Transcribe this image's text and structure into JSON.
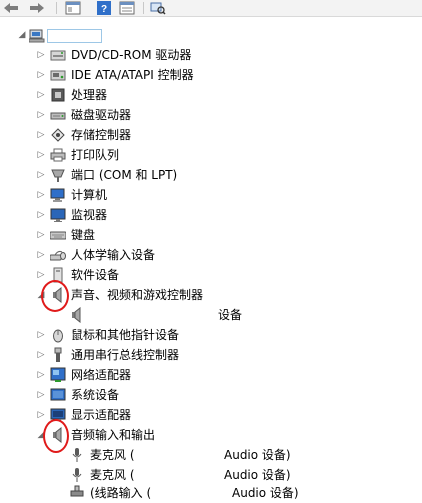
{
  "tree": {
    "root": {
      "label": ""
    },
    "categories": [
      {
        "label": "DVD/CD-ROM 驱动器",
        "icon": "dvd-drive-icon"
      },
      {
        "label": "IDE ATA/ATAPI 控制器",
        "icon": "ide-controller-icon"
      },
      {
        "label": "处理器",
        "icon": "processor-icon"
      },
      {
        "label": "磁盘驱动器",
        "icon": "disk-drive-icon"
      },
      {
        "label": "存储控制器",
        "icon": "storage-controller-icon"
      },
      {
        "label": "打印队列",
        "icon": "printer-icon"
      },
      {
        "label": "端口 (COM 和 LPT)",
        "icon": "port-icon"
      },
      {
        "label": "计算机",
        "icon": "computer-icon"
      },
      {
        "label": "监视器",
        "icon": "monitor-icon"
      },
      {
        "label": "键盘",
        "icon": "keyboard-icon"
      },
      {
        "label": "人体学输入设备",
        "icon": "hid-icon"
      },
      {
        "label": "软件设备",
        "icon": "software-device-icon"
      }
    ],
    "sound": {
      "label": "声音、视频和游戏控制器",
      "child_label": "设备"
    },
    "categories2": [
      {
        "label": "鼠标和其他指针设备",
        "icon": "mouse-icon"
      },
      {
        "label": "通用串行总线控制器",
        "icon": "usb-icon"
      },
      {
        "label": "网络适配器",
        "icon": "network-adapter-icon"
      },
      {
        "label": "系统设备",
        "icon": "system-device-icon"
      },
      {
        "label": "显示适配器",
        "icon": "display-adapter-icon"
      }
    ],
    "audio_io": {
      "label": "音频输入和输出",
      "children": [
        {
          "label": "麦克风 (",
          "suffix": "Audio 设备)"
        },
        {
          "label": "麦克风 (",
          "suffix": "Audio 设备)"
        },
        {
          "label": "(线路输入 (",
          "suffix": "Audio 设备)"
        }
      ]
    }
  },
  "colors": {
    "annotation": "#e01a1a",
    "selection": "#9dc7e6"
  }
}
